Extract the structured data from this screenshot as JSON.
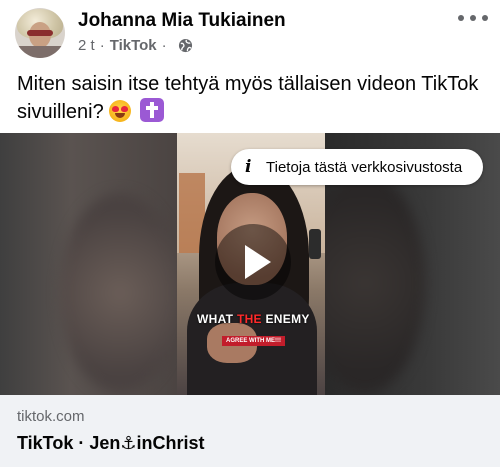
{
  "post": {
    "author": "Johanna Mia Tukiainen",
    "time": "2 t",
    "source": "TikTok",
    "text": "Miten saisin itse tehtyä myös tällaisen videon TikTok sivuilleni?",
    "emojis": [
      "smiling-face-with-heart-eyes",
      "latin-cross"
    ]
  },
  "video": {
    "info_label": "Tietoja tästä verkkosivustosta",
    "caption_word1": "WHAT",
    "caption_word2": "THE",
    "caption_word3": "ENEMY",
    "caption_sub": "AGREE WITH ME!!!"
  },
  "link": {
    "domain": "tiktok.com",
    "title": "TikTok · Jen⚓inChrist"
  },
  "colors": {
    "text": "#050505",
    "secondary": "#65676b",
    "footer_bg": "#f0f2f5",
    "caption_highlight": "#ff2a2a"
  }
}
